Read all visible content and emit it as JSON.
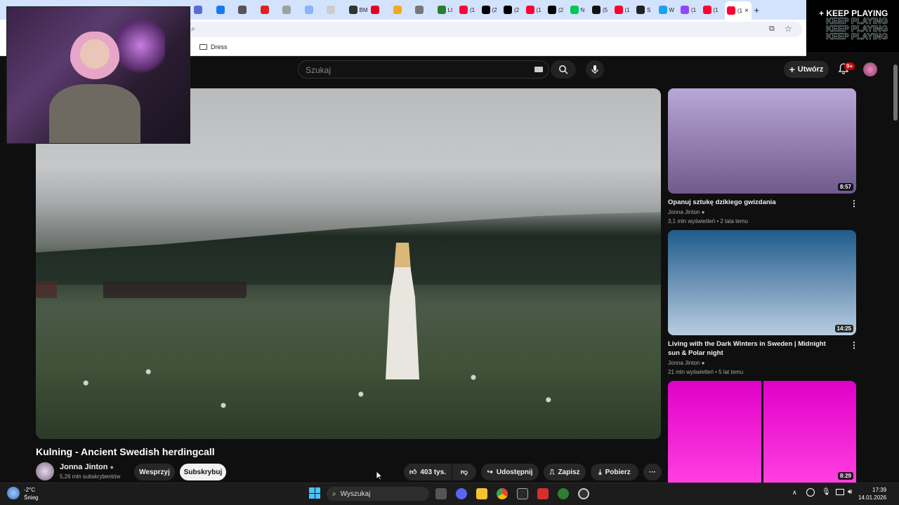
{
  "browser": {
    "tabs": [
      {
        "label": "",
        "color": "#5b6bd6"
      },
      {
        "label": "",
        "color": "#1877f2"
      },
      {
        "label": "",
        "color": "#555"
      },
      {
        "label": "",
        "color": "#e02020"
      },
      {
        "label": "",
        "color": "#a0a0a0"
      },
      {
        "label": "",
        "color": "#8ab4f8"
      },
      {
        "label": "",
        "color": "#ccc"
      },
      {
        "label": "BM",
        "color": "#333"
      },
      {
        "label": "",
        "color": "#e60023"
      },
      {
        "label": "",
        "color": "#f5a623"
      },
      {
        "label": "",
        "color": "#777"
      },
      {
        "label": "Lt",
        "color": "#2e7d32"
      },
      {
        "label": "(1",
        "color": "#ff0033"
      },
      {
        "label": "(2",
        "color": "#000"
      },
      {
        "label": "(2",
        "color": "#000"
      },
      {
        "label": "(1",
        "color": "#ff0033"
      },
      {
        "label": "(2",
        "color": "#000"
      },
      {
        "label": "N",
        "color": "#00c853"
      },
      {
        "label": "(5",
        "color": "#111"
      },
      {
        "label": "(1",
        "color": "#ff0033"
      },
      {
        "label": "S",
        "color": "#222"
      },
      {
        "label": "W",
        "color": "#1da1f2"
      },
      {
        "label": "(1",
        "color": "#9146ff"
      },
      {
        "label": "(1",
        "color": "#ff0033"
      },
      {
        "label": "(1",
        "color": "#ff0033",
        "active": true
      }
    ],
    "bookmark_folder": "Dress"
  },
  "overlay": {
    "keep_playing": "KEEP PLAYING"
  },
  "youtube": {
    "search_placeholder": "Szukaj",
    "create_label": "Utwórz",
    "notifications_count": "9+",
    "video": {
      "title": "Kulning - Ancient Swedish herdingcall",
      "channel": "Jonna Jinton",
      "subscribers": "5,26 mln subskrybentów",
      "support_label": "Wesprzyj",
      "subscribe_label": "Subskrybuj",
      "likes": "403 tys.",
      "share_label": "Udostępnij",
      "save_label": "Zapisz",
      "download_label": "Pobierz",
      "more_label": "···"
    },
    "related": [
      {
        "title": "Opanuj sztukę dzikiego gwizdania",
        "channel": "Jonna Jinton",
        "meta": "3,1 mln wyświetleń • 2 lata temu",
        "duration": "8:57",
        "color_top": "#b9a7d8",
        "color_bottom": "#6f5a8c"
      },
      {
        "title": "Living with the Dark Winters in Sweden | Midnight sun & Polar night",
        "channel": "Jonna Jinton",
        "meta": "21 mln wyświetleń • 5 lat temu",
        "duration": "14:25",
        "color_top": "#1f5b8a",
        "color_bottom": "#b9cde0"
      },
      {
        "title": "",
        "channel": "",
        "meta": "",
        "duration": "8:29",
        "color_top": "#e000c8",
        "color_bottom": "#ff3fe0"
      }
    ]
  },
  "taskbar": {
    "weather_temp": "-2°C",
    "weather_desc": "Śnieg",
    "search_label": "Wyszukaj",
    "time": "17:39",
    "date": "14.01.2026"
  }
}
